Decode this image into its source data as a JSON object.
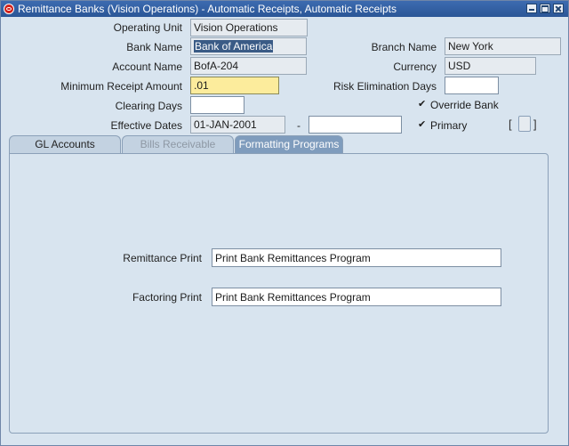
{
  "window": {
    "title": "Remittance Banks (Vision Operations) - Automatic Receipts, Automatic Receipts"
  },
  "form": {
    "operating_unit": {
      "label": "Operating Unit",
      "value": "Vision Operations"
    },
    "bank_name": {
      "label": "Bank Name",
      "value": "Bank of America"
    },
    "branch_name": {
      "label": "Branch Name",
      "value": "New York"
    },
    "account_name": {
      "label": "Account Name",
      "value": "BofA-204"
    },
    "currency": {
      "label": "Currency",
      "value": "USD"
    },
    "min_receipt_amount": {
      "label": "Minimum Receipt Amount",
      "value": ".01"
    },
    "risk_elimination_days": {
      "label": "Risk Elimination Days",
      "value": ""
    },
    "clearing_days": {
      "label": "Clearing Days",
      "value": ""
    },
    "override_bank": {
      "label": "Override Bank",
      "checked": true
    },
    "effective_dates": {
      "label": "Effective Dates",
      "from": "01-JAN-2001",
      "separator": "-",
      "to": ""
    },
    "primary": {
      "label": "Primary",
      "checked": true
    },
    "brackets": {
      "open": "[",
      "close": "]"
    }
  },
  "tabs": [
    {
      "label": "GL Accounts",
      "state": "normal"
    },
    {
      "label": "Bills Receivable",
      "state": "disabled"
    },
    {
      "label": "Formatting Programs",
      "state": "active"
    }
  ],
  "formatting": {
    "remittance_print": {
      "label": "Remittance Print",
      "value": "Print Bank Remittances Program"
    },
    "factoring_print": {
      "label": "Factoring Print",
      "value": "Print Bank Remittances Program"
    }
  },
  "icons": {
    "check": "✔"
  },
  "colors": {
    "titlebar": "#2b5697",
    "required_field": "#fcec9c",
    "active_tab": "#7f9cbd",
    "form_bg": "#d8e4ef"
  }
}
